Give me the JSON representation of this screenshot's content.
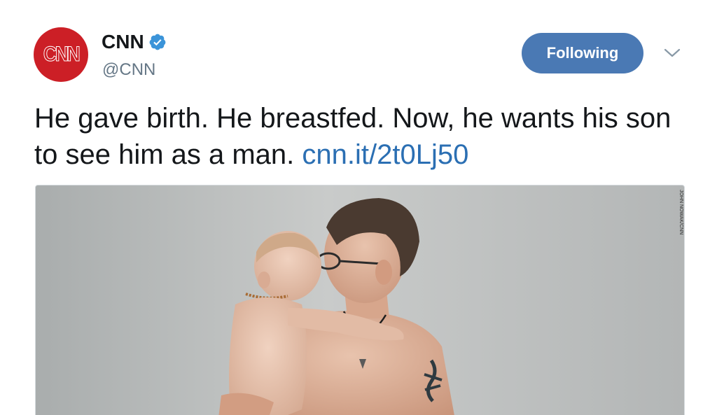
{
  "account": {
    "avatar_text": "CNN",
    "display_name": "CNN",
    "handle": "@CNN",
    "verified": true,
    "avatar_color": "#cc1f26"
  },
  "actions": {
    "follow_label": "Following",
    "follow_color": "#4a79b4",
    "menu_icon": "chevron-down-icon"
  },
  "tweet": {
    "text": "He gave birth. He breastfed. Now, he wants his son to see him as a man. ",
    "link": "cnn.it/2t0Lj50",
    "link_color": "#2b6fb3"
  },
  "media": {
    "photo_credit": "JOHN NOWAK/CNN"
  }
}
